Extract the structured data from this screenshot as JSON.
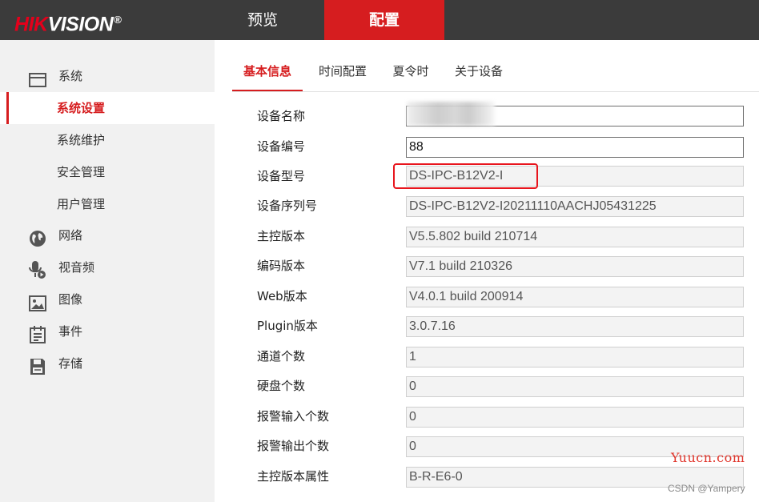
{
  "brand": {
    "logo_red": "HIK",
    "logo_white": "VISION",
    "logo_mark": "®"
  },
  "top_nav": {
    "preview": "预览",
    "config": "配置"
  },
  "sidebar": {
    "system": "系统",
    "system_settings": "系统设置",
    "system_maintenance": "系统维护",
    "security": "安全管理",
    "user_management": "用户管理",
    "network": "网络",
    "video_audio": "视音频",
    "image": "图像",
    "event": "事件",
    "storage": "存储"
  },
  "tabs": [
    "基本信息",
    "时间配置",
    "夏令时",
    "关于设备"
  ],
  "form": {
    "rows": [
      {
        "label": "设备名称",
        "value": ""
      },
      {
        "label": "设备编号",
        "value": "88"
      },
      {
        "label": "设备型号",
        "value": "DS-IPC-B12V2-I"
      },
      {
        "label": "设备序列号",
        "value": "DS-IPC-B12V2-I20211110AACHJ05431225"
      },
      {
        "label": "主控版本",
        "value": "V5.5.802 build 210714"
      },
      {
        "label": "编码版本",
        "value": "V7.1 build 210326"
      },
      {
        "label": "Web版本",
        "value": "V4.0.1 build 200914"
      },
      {
        "label": "Plugin版本",
        "value": "3.0.7.16"
      },
      {
        "label": "通道个数",
        "value": "1"
      },
      {
        "label": "硬盘个数",
        "value": "0"
      },
      {
        "label": "报警输入个数",
        "value": "0"
      },
      {
        "label": "报警输出个数",
        "value": "0"
      },
      {
        "label": "主控版本属性",
        "value": "B-R-E6-0"
      }
    ]
  },
  "watermarks": {
    "site": "Yuucn.com",
    "credit": "CSDN @Yampery"
  },
  "colors": {
    "accent": "#d61d1f",
    "topbar": "#3b3b3b",
    "sidebar": "#f1f1f1",
    "highlight_box": "#e8151d"
  }
}
